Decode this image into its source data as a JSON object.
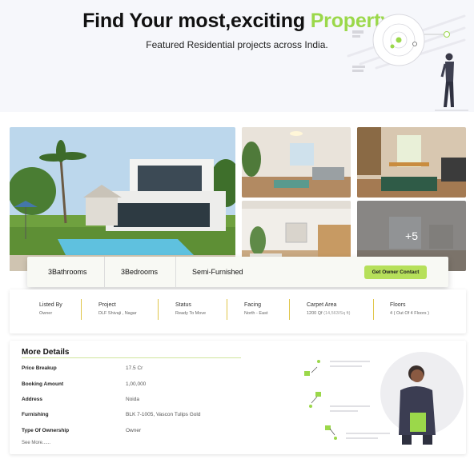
{
  "hero": {
    "title_prefix": "Find Your most,exciting ",
    "title_accent": "Property",
    "subtitle": "Featured Residential projects across India."
  },
  "gallery": {
    "more_label": "+5"
  },
  "features": {
    "bathrooms": "3Bathrooms",
    "bedrooms": "3Bedrooms",
    "furnishing": "Semi-Furnished",
    "contact_button": "Get Owner Contact"
  },
  "specs": [
    {
      "label": "Listed By",
      "value": "Owner",
      "sub": ""
    },
    {
      "label": "Project",
      "value": "DLF Shivaji , Nagar",
      "sub": ""
    },
    {
      "label": "Status",
      "value": "Ready To Move",
      "sub": ""
    },
    {
      "label": "Facing",
      "value": "North - East",
      "sub": ""
    },
    {
      "label": "Carpet Area",
      "value": "1200 Qf",
      "sub": "(14,563/Sq ft)"
    },
    {
      "label": "Floors",
      "value": "4 ( Out Of 4 Floors )",
      "sub": ""
    }
  ],
  "details": {
    "title": "More Details",
    "rows": [
      {
        "label": "Price Breakup",
        "value": "17.5 Cr"
      },
      {
        "label": "Booking Amount",
        "value": "1,00,000"
      },
      {
        "label": "Address",
        "value": "Noida"
      },
      {
        "label": "Furnishing",
        "value": "BLK 7-1005, Vascon Tulips Gold"
      },
      {
        "label": "Type Of Ownership",
        "value": "Owner"
      }
    ],
    "see_more": "See More......"
  },
  "colors": {
    "accent": "#9bd84a",
    "button": "#b6e05a",
    "divider": "#e0c64a"
  }
}
